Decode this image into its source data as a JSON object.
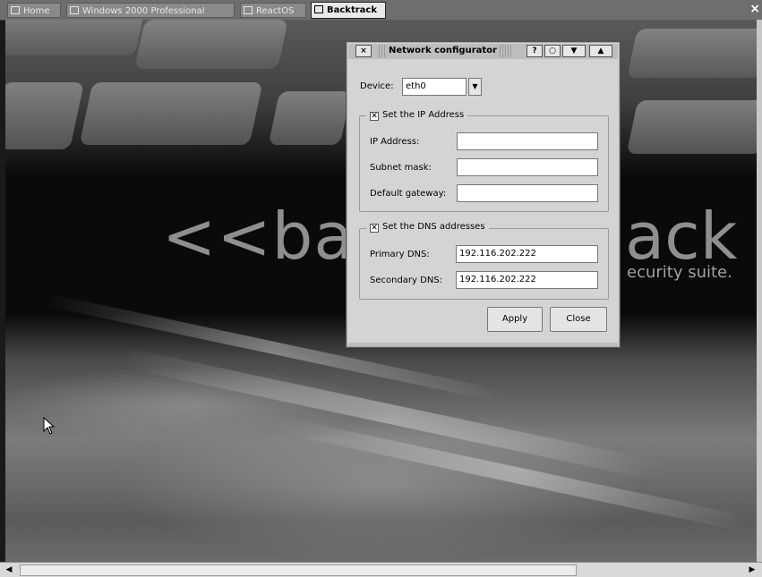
{
  "tabs": [
    {
      "label": "Home",
      "icon": "home-icon"
    },
    {
      "label": "Windows 2000 Professional",
      "icon": "vm-icon"
    },
    {
      "label": "ReactOS",
      "icon": "vm-icon"
    },
    {
      "label": "Backtrack",
      "icon": "vm-icon",
      "active": true
    }
  ],
  "close_glyph": "×",
  "wallpaper": {
    "brand_left": "<<ba",
    "brand_right": "ack",
    "tagline": "ecurity suite."
  },
  "dialog": {
    "title": "Network configurator",
    "close_glyph": "×",
    "help_glyph": "?",
    "device_label": "Device:",
    "device_value": "eth0",
    "ip_group": {
      "label": "Set the IP Address",
      "checked": true,
      "ip_label": "IP Address:",
      "ip_value": "",
      "mask_label": "Subnet mask:",
      "mask_value": "",
      "gateway_label": "Default gateway:",
      "gateway_value": ""
    },
    "dns_group": {
      "label": "Set the DNS addresses",
      "checked": true,
      "primary_label": "Primary DNS:",
      "primary_value": "192.116.202.222",
      "secondary_label": "Secondary DNS:",
      "secondary_value": "192.116.202.222"
    },
    "apply_label": "Apply",
    "close_label": "Close"
  },
  "colors": {
    "tabbar": "#6e6e6e",
    "dialog": "#d4d4d4",
    "active_tab": "#e8e8e8"
  }
}
